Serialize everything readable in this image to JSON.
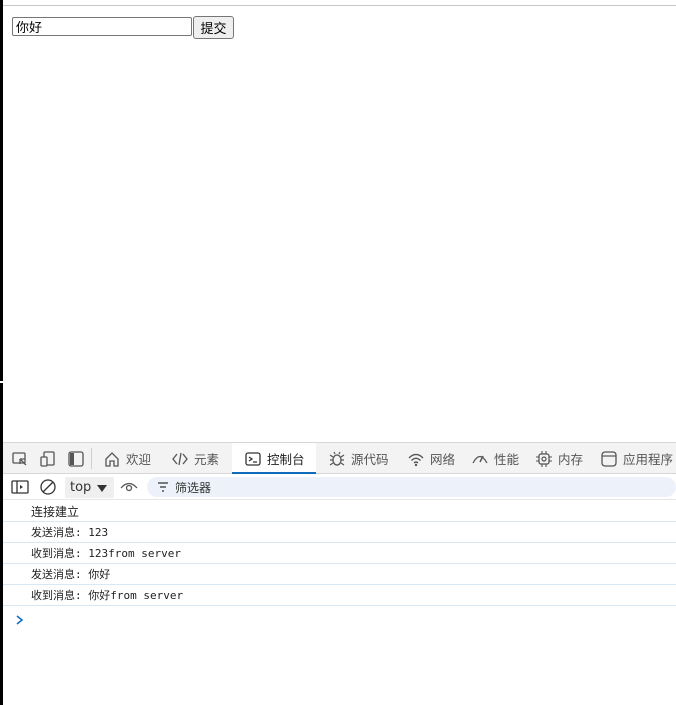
{
  "page": {
    "input_value": "你好",
    "submit_label": "提交"
  },
  "devtools": {
    "tabs": [
      {
        "label": "欢迎",
        "icon": "home-icon"
      },
      {
        "label": "元素",
        "icon": "code-icon"
      },
      {
        "label": "控制台",
        "icon": "console-icon"
      },
      {
        "label": "源代码",
        "icon": "bug-icon"
      },
      {
        "label": "网络",
        "icon": "wifi-icon"
      },
      {
        "label": "性能",
        "icon": "performance-icon"
      },
      {
        "label": "内存",
        "icon": "chip-icon"
      },
      {
        "label": "应用程序",
        "icon": "app-icon"
      }
    ],
    "active_tab": "控制台",
    "context": "top",
    "filter_placeholder": "筛选器",
    "accent_color": "#0f6cbd",
    "logs": [
      "连接建立",
      "发送消息: 123",
      "收到消息: 123from server",
      "发送消息: 你好",
      "收到消息: 你好from server"
    ]
  }
}
